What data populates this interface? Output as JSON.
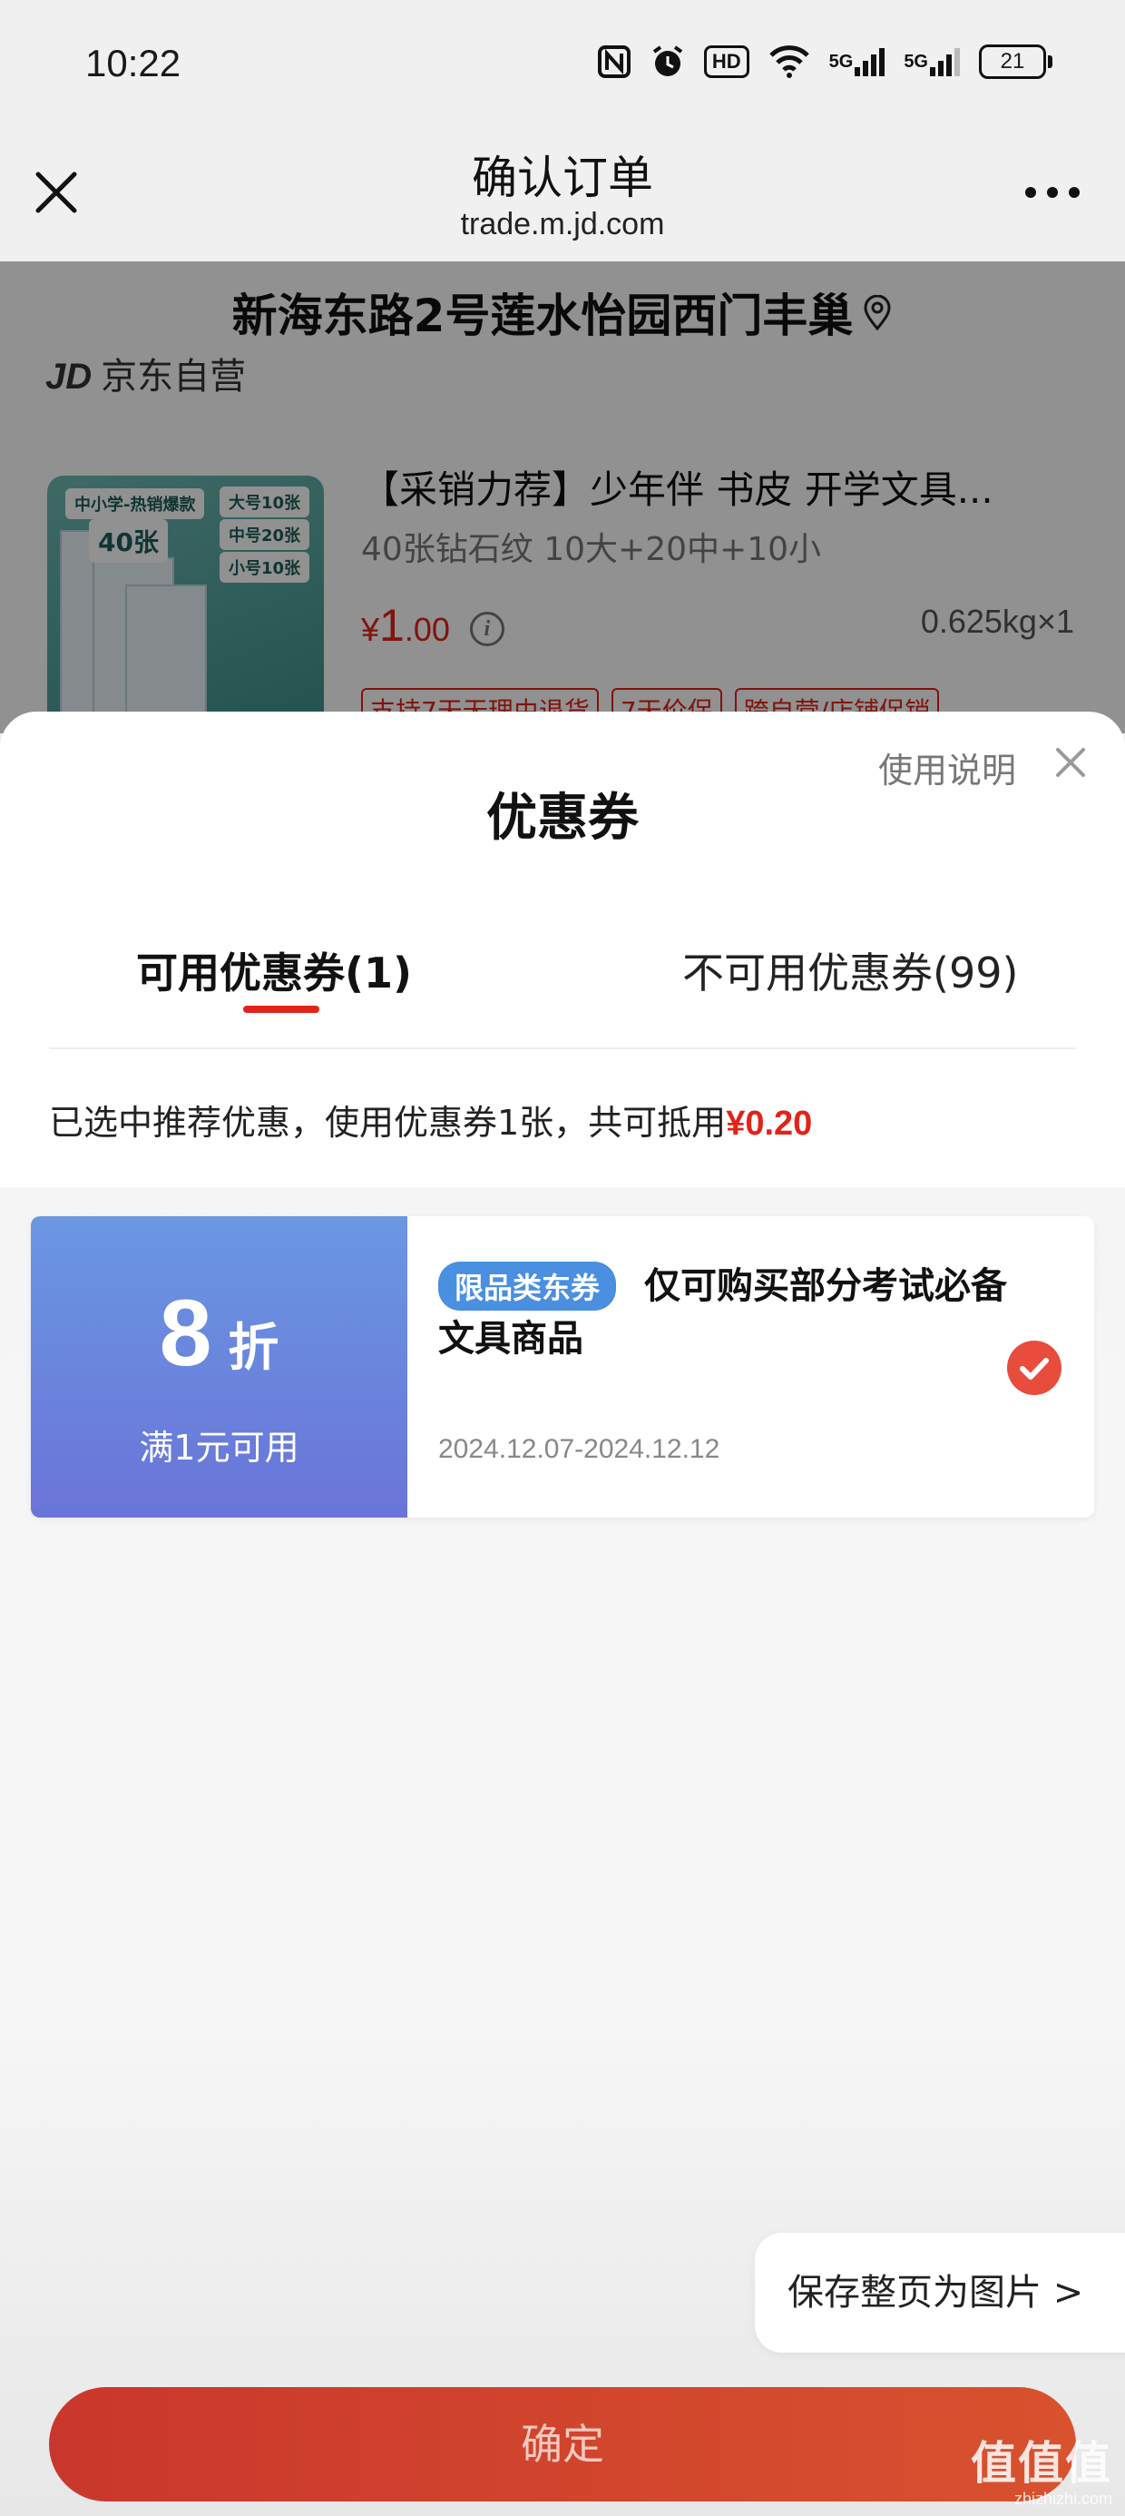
{
  "status_bar": {
    "time": "10:22",
    "icons": [
      "nfc-icon",
      "alarm-icon",
      "hd-icon",
      "wifi-icon",
      "5g-signal-icon",
      "5g-signal-icon",
      "battery-icon"
    ],
    "hd_label": "HD",
    "net_label_1": "5G",
    "net_label_2": "5G",
    "battery": "21"
  },
  "nav": {
    "title": "确认订单",
    "subtitle": "trade.m.jd.com"
  },
  "background_page": {
    "address": "新海东路2号莲水怡园西门丰巢",
    "shop": "京东自营",
    "product": {
      "title": "【采销力荐】少年伴 书皮 开学文具...",
      "spec": "40张钻石纹 10大+20中+10小",
      "price_currency": "¥",
      "price_int": "1",
      "price_dec": ".00",
      "weight": "0.625kg×1",
      "image_labels": [
        "中小学-热销爆款",
        "40张",
        "大号10张",
        "中号20张",
        "小号10张"
      ],
      "tags": [
        "支持7天无理由退货",
        "7天价保",
        "跨自营/店铺促销"
      ]
    }
  },
  "sheet": {
    "title": "优惠券",
    "help": "使用说明",
    "tabs": [
      {
        "label": "可用优惠券(1)",
        "active": true
      },
      {
        "label": "不可用优惠券(99)",
        "active": false
      }
    ],
    "summary_text": "已选中推荐优惠，使用优惠券1张，共可抵用",
    "summary_amount": "¥0.20",
    "coupon": {
      "discount_value": "8",
      "discount_unit": "折",
      "condition": "满1元可用",
      "badge": "限品类东券",
      "description_line1": "仅可购买部分考试必备",
      "description_line2": "文具商品",
      "date_range": "2024.12.07-2024.12.12",
      "selected": true
    }
  },
  "bottom": {
    "save_page": "保存整页为图片 >",
    "confirm": "确定"
  },
  "watermark": {
    "text": "值值值",
    "url": "zhizhizhi.com"
  },
  "colors": {
    "accent_red": "#e2231a",
    "coupon_blue": "#6a87dd",
    "badge_blue": "#4a8fe0",
    "confirm_red": "#c9372c"
  }
}
